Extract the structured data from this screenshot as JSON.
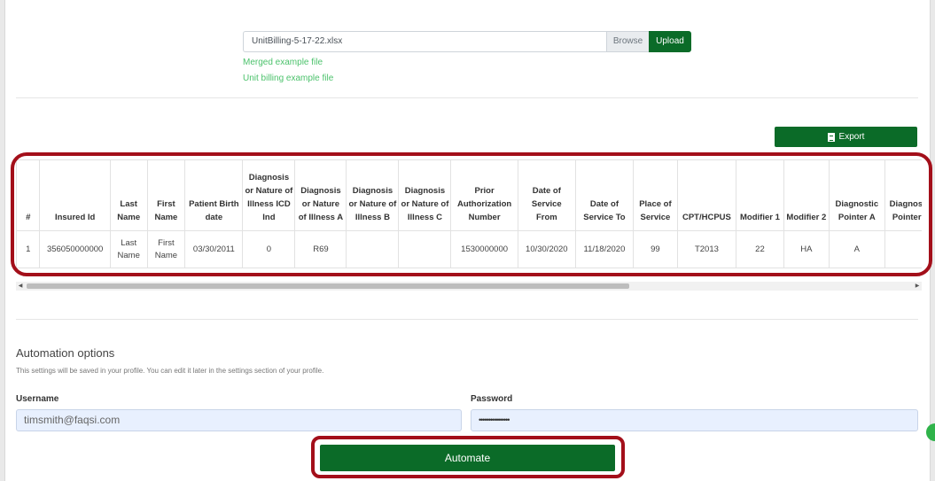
{
  "upload": {
    "file_name": "UnitBilling-5-17-22.xlsx",
    "browse_label": "Browse",
    "upload_label": "Upload",
    "links": [
      "Merged example file",
      "Unit billing example file"
    ]
  },
  "export_label": "Export",
  "table": {
    "headers": [
      "#",
      "Insured Id",
      "Last Name",
      "First Name",
      "Patient Birth date",
      "Diagnosis or Nature of Illness ICD Ind",
      "Diagnosis or Nature of Illness A",
      "Diagnosis or Nature of Illness B",
      "Diagnosis or Nature of Illness C",
      "Prior Authorization Number",
      "Date of Service From",
      "Date of Service To",
      "Place of Service",
      "CPT/HCPUS",
      "Modifier 1",
      "Modifier 2",
      "Diagnostic Pointer A",
      "Diagnostic Pointer B"
    ],
    "rows": [
      [
        "1",
        "356050000000",
        "Last Name",
        "First Name",
        "03/30/2011",
        "0",
        "R69",
        "",
        "",
        "1530000000",
        "10/30/2020",
        "11/18/2020",
        "99",
        "T2013",
        "22",
        "HA",
        "A",
        ""
      ]
    ]
  },
  "automation": {
    "title": "Automation options",
    "description": "This settings will be saved in your profile. You can edit it later in the settings section of your profile.",
    "username_label": "Username",
    "username_value": "timsmith@faqsi.com",
    "password_label": "Password",
    "password_value": "••••••••••••••••",
    "automate_label": "Automate"
  },
  "colors": {
    "primary": "#0b6b28",
    "link": "#4cc26c",
    "highlight": "#a30f1a"
  }
}
